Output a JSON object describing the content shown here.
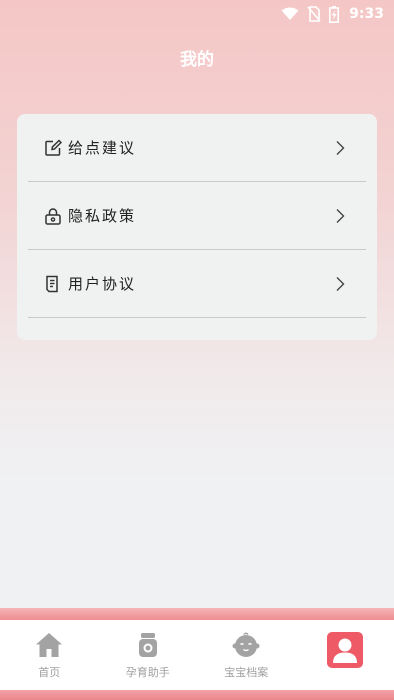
{
  "status_bar": {
    "time": "9:33",
    "icons": [
      "wifi-icon",
      "no-sim-icon",
      "battery-charging-icon"
    ]
  },
  "header": {
    "title": "我的"
  },
  "menu": {
    "items": [
      {
        "label": "给点建议",
        "icon": "edit-icon"
      },
      {
        "label": "隐私政策",
        "icon": "lock-icon"
      },
      {
        "label": "用户协议",
        "icon": "document-icon"
      }
    ]
  },
  "tabbar": {
    "tabs": [
      {
        "label": "首页",
        "icon": "home-icon"
      },
      {
        "label": "孕育助手",
        "icon": "bottle-icon"
      },
      {
        "label": "宝宝档案",
        "icon": "baby-face-icon"
      },
      {
        "label": "",
        "icon": "user-icon",
        "active": true
      }
    ]
  },
  "colors": {
    "accent": "#ee5a66",
    "header_gradient_top": "#f4c7c6",
    "background": "#f0f1f3",
    "tab_inactive": "#a0a0a0"
  }
}
